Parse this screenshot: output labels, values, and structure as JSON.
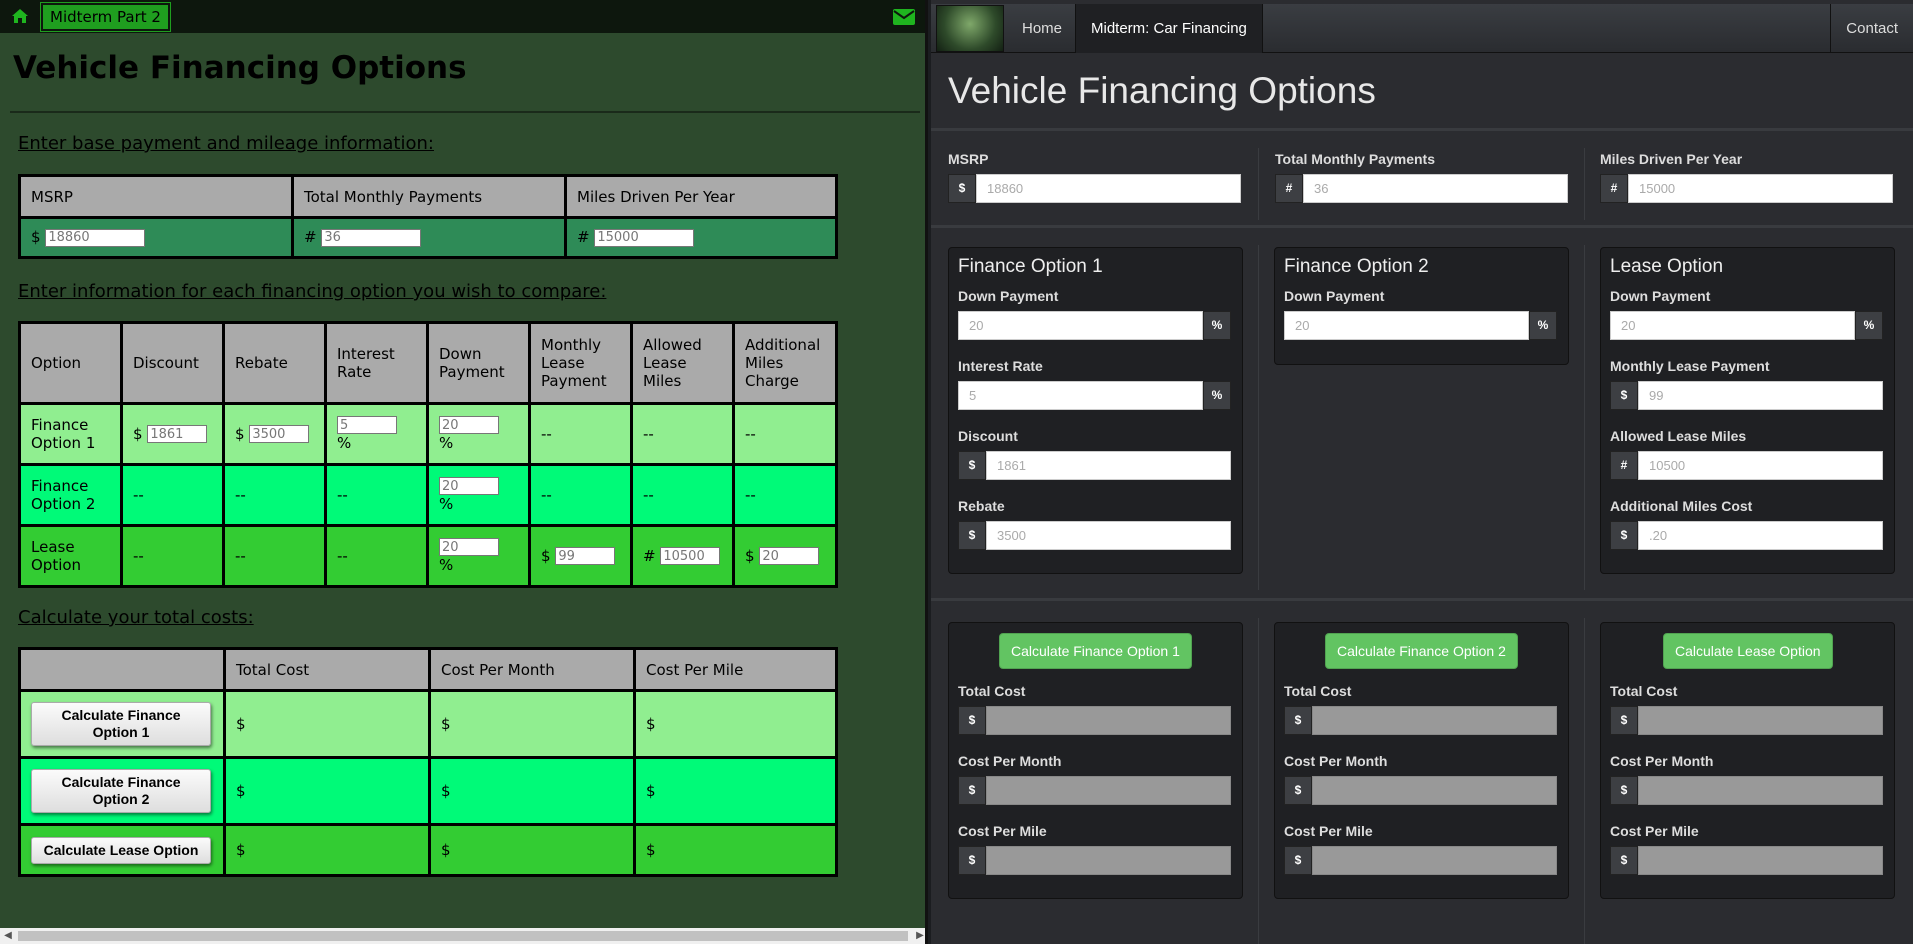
{
  "left": {
    "tab_label": "Midterm Part 2",
    "title": "Vehicle Financing Options",
    "section1": "Enter base payment and mileage information:",
    "base_headers": [
      "MSRP",
      "Total Monthly Payments",
      "Miles Driven Per Year"
    ],
    "base_prefixes": [
      "$",
      "#",
      "#"
    ],
    "base_values": [
      "18860",
      "36",
      "15000"
    ],
    "section2": "Enter information for each financing option you wish to compare:",
    "option_headers": [
      "Option",
      "Discount",
      "Rebate",
      "Interest Rate",
      "Down Payment",
      "Monthly Lease Payment",
      "Allowed Lease Miles",
      "Additional Miles Charge"
    ],
    "options": [
      {
        "name": "Finance Option 1",
        "discount": "1861",
        "rebate": "3500",
        "interest": "5",
        "down": "20",
        "dash": "--"
      },
      {
        "name": "Finance Option 2",
        "down": "20",
        "dash": "--"
      },
      {
        "name": "Lease Option",
        "down": "20",
        "monthly": "99",
        "miles": "10500",
        "charge": "20",
        "dash": "--"
      }
    ],
    "unit_dollar": "$",
    "unit_pct": "%",
    "unit_hash": "#",
    "section3": "Calculate your total costs:",
    "cost_headers": [
      "Total Cost",
      "Cost Per Month",
      "Cost Per Mile"
    ],
    "calc_buttons": [
      "Calculate Finance Option 1",
      "Calculate Finance Option 2",
      "Calculate Lease Option"
    ],
    "cost_cell": "$",
    "colors": {
      "row1": "#90ee90",
      "row2": "#00fa78",
      "row3": "#33cc33",
      "base_row": "#2e8b57"
    }
  },
  "right": {
    "nav": {
      "home": "Home",
      "active": "Midterm: Car Financing",
      "contact": "Contact"
    },
    "title": "Vehicle Financing Options",
    "base": [
      {
        "label": "MSRP",
        "addon": "$",
        "value": "18860"
      },
      {
        "label": "Total Monthly Payments",
        "addon": "#",
        "value": "36"
      },
      {
        "label": "Miles Driven Per Year",
        "addon": "#",
        "value": "15000"
      }
    ],
    "finance1": {
      "title": "Finance Option 1",
      "down_label": "Down Payment",
      "down": "20",
      "interest_label": "Interest Rate",
      "interest": "5",
      "discount_label": "Discount",
      "discount": "1861",
      "rebate_label": "Rebate",
      "rebate": "3500"
    },
    "finance2": {
      "title": "Finance Option 2",
      "down_label": "Down Payment",
      "down": "20"
    },
    "lease": {
      "title": "Lease Option",
      "down_label": "Down Payment",
      "down": "20",
      "monthly_label": "Monthly Lease Payment",
      "monthly": "99",
      "miles_label": "Allowed Lease Miles",
      "miles": "10500",
      "cost_label": "Additional Miles Cost",
      "cost": ".20"
    },
    "addons": {
      "pct": "%",
      "dollar": "$",
      "hash": "#"
    },
    "calc": [
      {
        "button": "Calculate Finance Option 1"
      },
      {
        "button": "Calculate Finance Option 2"
      },
      {
        "button": "Calculate Lease Option"
      }
    ],
    "result_labels": [
      "Total Cost",
      "Cost Per Month",
      "Cost Per Mile"
    ],
    "colors": {
      "button": "#62c462",
      "background": "#2b2c30",
      "well": "#1f2023"
    }
  }
}
